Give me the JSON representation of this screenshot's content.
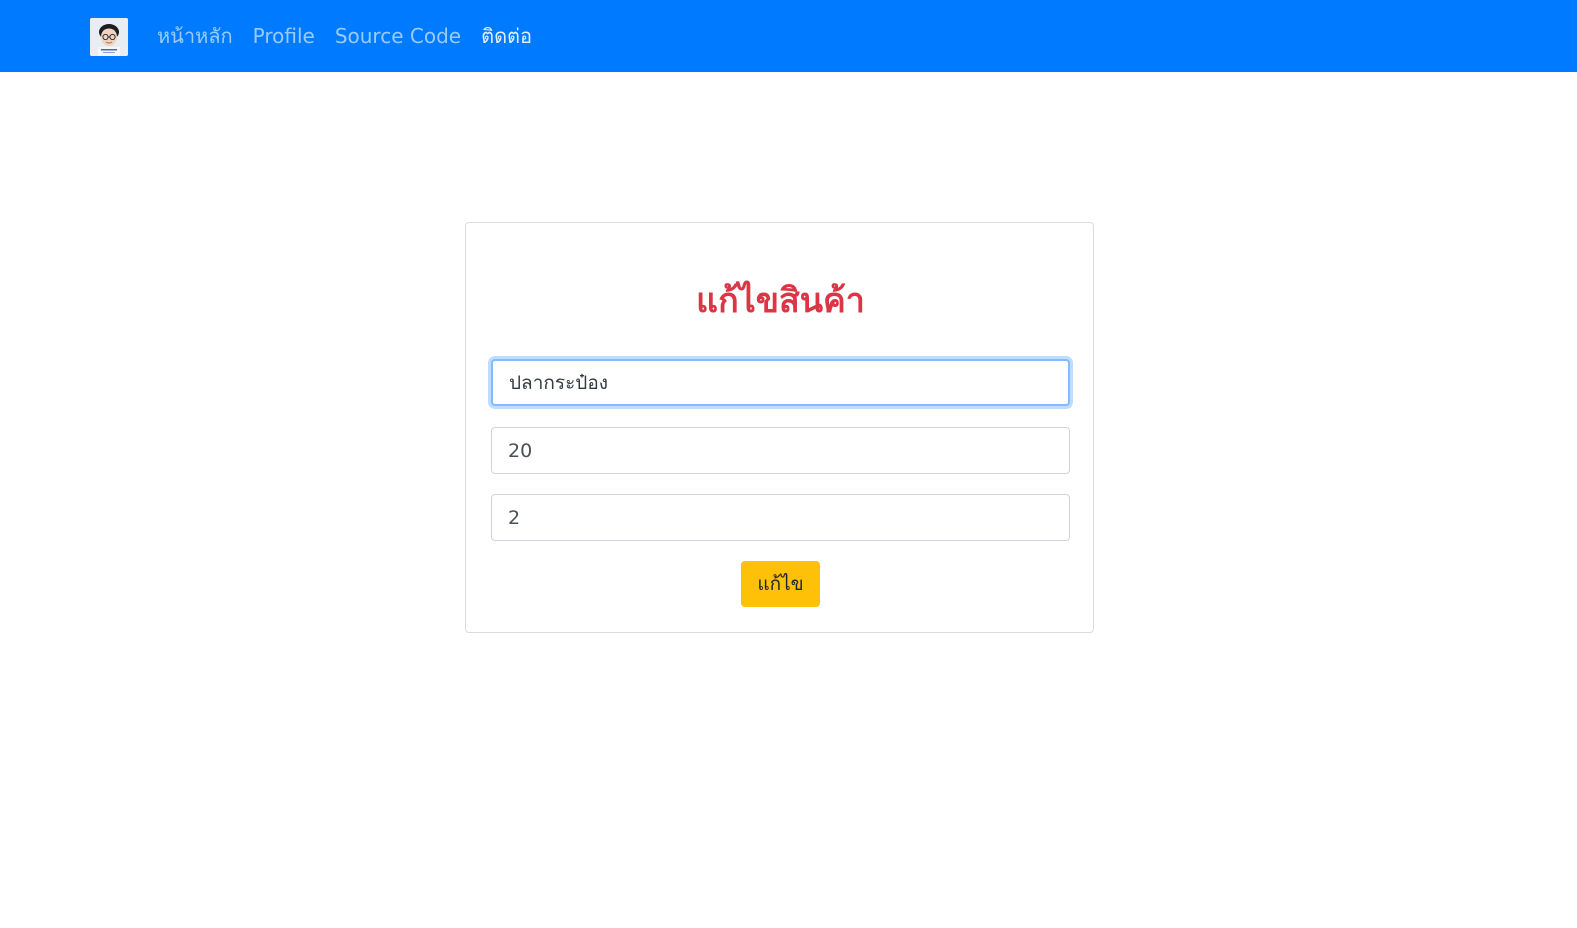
{
  "navbar": {
    "logo_icon": "profile-avatar-icon",
    "background": "#007bff",
    "links": [
      {
        "label": "หน้าหลัก"
      },
      {
        "label": "Profile"
      },
      {
        "label": "Source Code"
      },
      {
        "label": "ติดต่อ"
      }
    ]
  },
  "form": {
    "title": "แก้ไขสินค้า",
    "title_color": "#dc3545",
    "fields": [
      {
        "value": "ปลากระป๋อง"
      },
      {
        "value": "20"
      },
      {
        "value": "2"
      }
    ],
    "submit_label": "แก้ไข",
    "submit_color": "#ffc107"
  }
}
